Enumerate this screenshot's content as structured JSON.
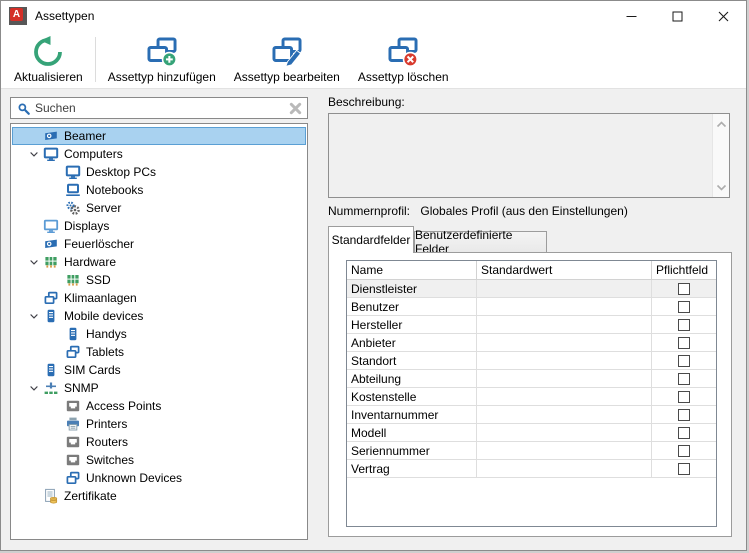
{
  "window": {
    "title": "Assettypen",
    "app_icon_letter": "A"
  },
  "toolbar": {
    "buttons": [
      {
        "label": "Aktualisieren"
      },
      {
        "label": "Assettyp hinzufügen"
      },
      {
        "label": "Assettyp bearbeiten"
      },
      {
        "label": "Assettyp löschen"
      }
    ]
  },
  "search": {
    "placeholder": "Suchen"
  },
  "tree": {
    "items": [
      {
        "label": "Beamer",
        "icon": "projector",
        "level": 0,
        "selected": true
      },
      {
        "label": "Computers",
        "icon": "monitor",
        "level": 0,
        "expanded": true
      },
      {
        "label": "Desktop PCs",
        "icon": "monitor",
        "level": 1
      },
      {
        "label": "Notebooks",
        "icon": "laptop",
        "level": 1
      },
      {
        "label": "Server",
        "icon": "gears",
        "level": 1
      },
      {
        "label": "Displays",
        "icon": "display",
        "level": 0
      },
      {
        "label": "Feuerlöscher",
        "icon": "projector",
        "level": 0
      },
      {
        "label": "Hardware",
        "icon": "chip",
        "level": 0,
        "expanded": true
      },
      {
        "label": "SSD",
        "icon": "chip",
        "level": 1
      },
      {
        "label": "Klimaanlagen",
        "icon": "frames",
        "level": 0
      },
      {
        "label": "Mobile devices",
        "icon": "phone",
        "level": 0,
        "expanded": true
      },
      {
        "label": "Handys",
        "icon": "phone",
        "level": 1
      },
      {
        "label": "Tablets",
        "icon": "frames",
        "level": 1
      },
      {
        "label": "SIM Cards",
        "icon": "phone",
        "level": 0
      },
      {
        "label": "SNMP",
        "icon": "network",
        "level": 0,
        "expanded": true
      },
      {
        "label": "Access Points",
        "icon": "port",
        "level": 1
      },
      {
        "label": "Printers",
        "icon": "printer",
        "level": 1
      },
      {
        "label": "Routers",
        "icon": "port",
        "level": 1
      },
      {
        "label": "Switches",
        "icon": "port",
        "level": 1
      },
      {
        "label": "Unknown Devices",
        "icon": "frames",
        "level": 1
      },
      {
        "label": "Zertifikate",
        "icon": "certificate",
        "level": 0
      }
    ]
  },
  "details": {
    "description_label": "Beschreibung:",
    "description_value": "",
    "number_profile_label": "Nummernprofil:",
    "number_profile_value": "Globales Profil (aus den Einstellungen)",
    "tabs": [
      {
        "label": "Standardfelder",
        "active": true
      },
      {
        "label": "Benutzerdefinierte Felder",
        "active": false
      }
    ],
    "fields_table": {
      "columns": [
        "Name",
        "Standardwert",
        "Pflichtfeld"
      ],
      "rows": [
        {
          "name": "Dienstleister",
          "standardwert": "",
          "pflichtfeld": false,
          "selected": true
        },
        {
          "name": "Benutzer",
          "standardwert": "",
          "pflichtfeld": false
        },
        {
          "name": "Hersteller",
          "standardwert": "",
          "pflichtfeld": false
        },
        {
          "name": "Anbieter",
          "standardwert": "",
          "pflichtfeld": false
        },
        {
          "name": "Standort",
          "standardwert": "",
          "pflichtfeld": false
        },
        {
          "name": "Abteilung",
          "standardwert": "",
          "pflichtfeld": false
        },
        {
          "name": "Kostenstelle",
          "standardwert": "",
          "pflichtfeld": false
        },
        {
          "name": "Inventarnummer",
          "standardwert": "",
          "pflichtfeld": false
        },
        {
          "name": "Modell",
          "standardwert": "",
          "pflichtfeld": false
        },
        {
          "name": "Seriennummer",
          "standardwert": "",
          "pflichtfeld": false
        },
        {
          "name": "Vertrag",
          "standardwert": "",
          "pflichtfeld": false
        }
      ]
    }
  },
  "colors": {
    "selection_bg": "#a9d2f0",
    "selection_border": "#5a9fd4",
    "icon_blue": "#2a6db3",
    "icon_green": "#36a378",
    "icon_red": "#d83b2e",
    "window_bg": "#f0f0f0"
  }
}
